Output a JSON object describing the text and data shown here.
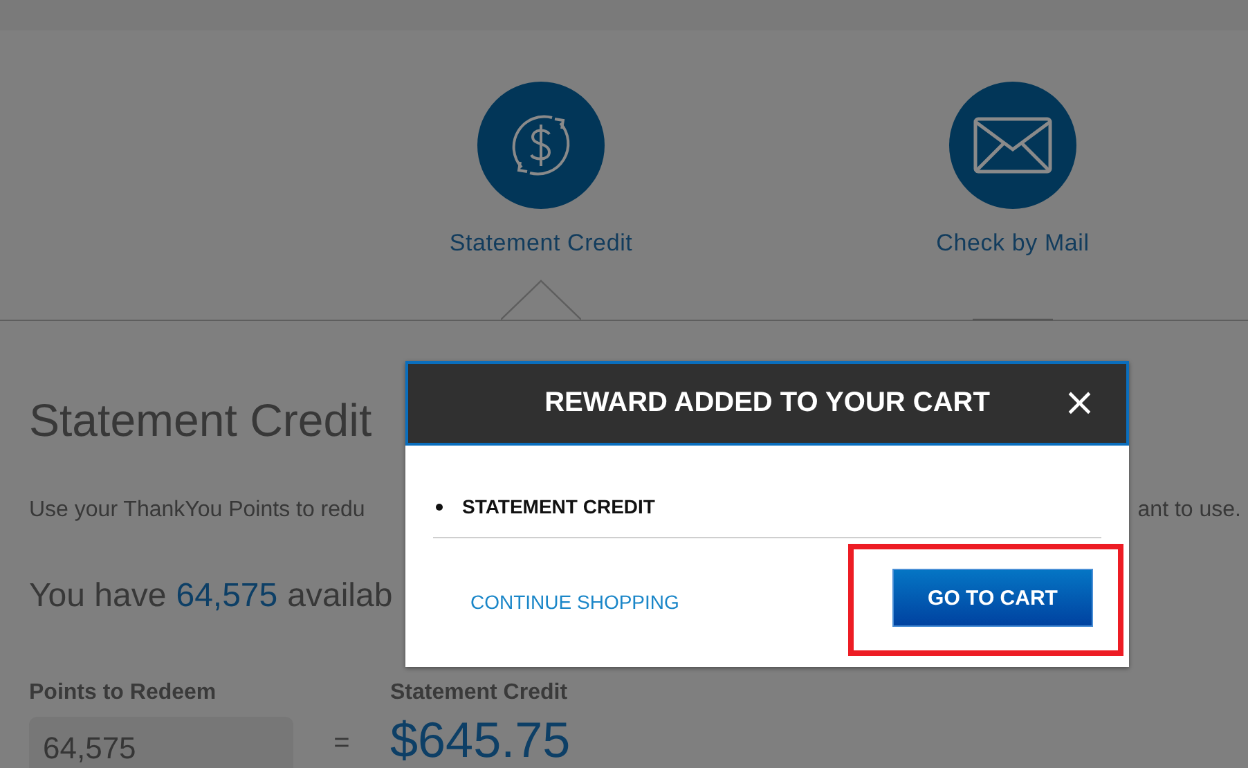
{
  "options": [
    {
      "label": "Statement Credit",
      "kind": "dollar",
      "selected": true
    },
    {
      "label": "Check by Mail",
      "kind": "mail",
      "selected": false
    }
  ],
  "section": {
    "heading": "Statement Credit",
    "description_start": "Use your ThankYou Points to redu",
    "description_end": "ant to use.",
    "balance_prefix": "You have",
    "balance_points": "64,575",
    "balance_suffix": "availab",
    "points_label": "Points to Redeem",
    "points_value": "64,575",
    "equals": "=",
    "credit_label": "Statement Credit",
    "credit_value": "$645.75"
  },
  "modal": {
    "title": "REWARD ADDED TO YOUR CART",
    "close": "×",
    "items": [
      "STATEMENT CREDIT"
    ],
    "secondary_action": "CONTINUE SHOPPING",
    "primary_action": "GO TO CART",
    "primary_highlighted": true
  }
}
